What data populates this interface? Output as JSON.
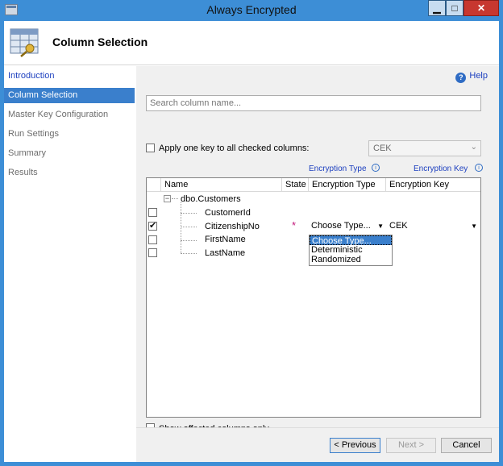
{
  "window": {
    "title": "Always Encrypted"
  },
  "header": {
    "title": "Column Selection"
  },
  "sidebar": {
    "items": [
      {
        "label": "Introduction"
      },
      {
        "label": "Column Selection"
      },
      {
        "label": "Master Key Configuration"
      },
      {
        "label": "Run Settings"
      },
      {
        "label": "Summary"
      },
      {
        "label": "Results"
      }
    ]
  },
  "help": {
    "label": "Help"
  },
  "search": {
    "placeholder": "Search column name..."
  },
  "apply_all": {
    "label": "Apply one key to all checked columns:",
    "checked": false,
    "key_value": "CEK"
  },
  "hints": {
    "encryption_type": "Encryption Type",
    "encryption_key": "Encryption Key"
  },
  "grid": {
    "headers": {
      "name": "Name",
      "state": "State",
      "encryption_type": "Encryption Type",
      "encryption_key": "Encryption Key"
    },
    "table_name": "dbo.Customers",
    "rows": [
      {
        "name": "CustomerId",
        "checked": false
      },
      {
        "name": "CitizenshipNo",
        "checked": true,
        "state": "*",
        "encryption_type": "Choose Type...",
        "encryption_key": "CEK"
      },
      {
        "name": "FirstName",
        "checked": false
      },
      {
        "name": "LastName",
        "checked": false
      }
    ],
    "type_options": [
      "Choose Type...",
      "Deterministic",
      "Randomized"
    ]
  },
  "show_affected": {
    "label": "Show affected columns only",
    "checked": false
  },
  "footer": {
    "previous": "< Previous",
    "next": "Next >",
    "cancel": "Cancel"
  }
}
